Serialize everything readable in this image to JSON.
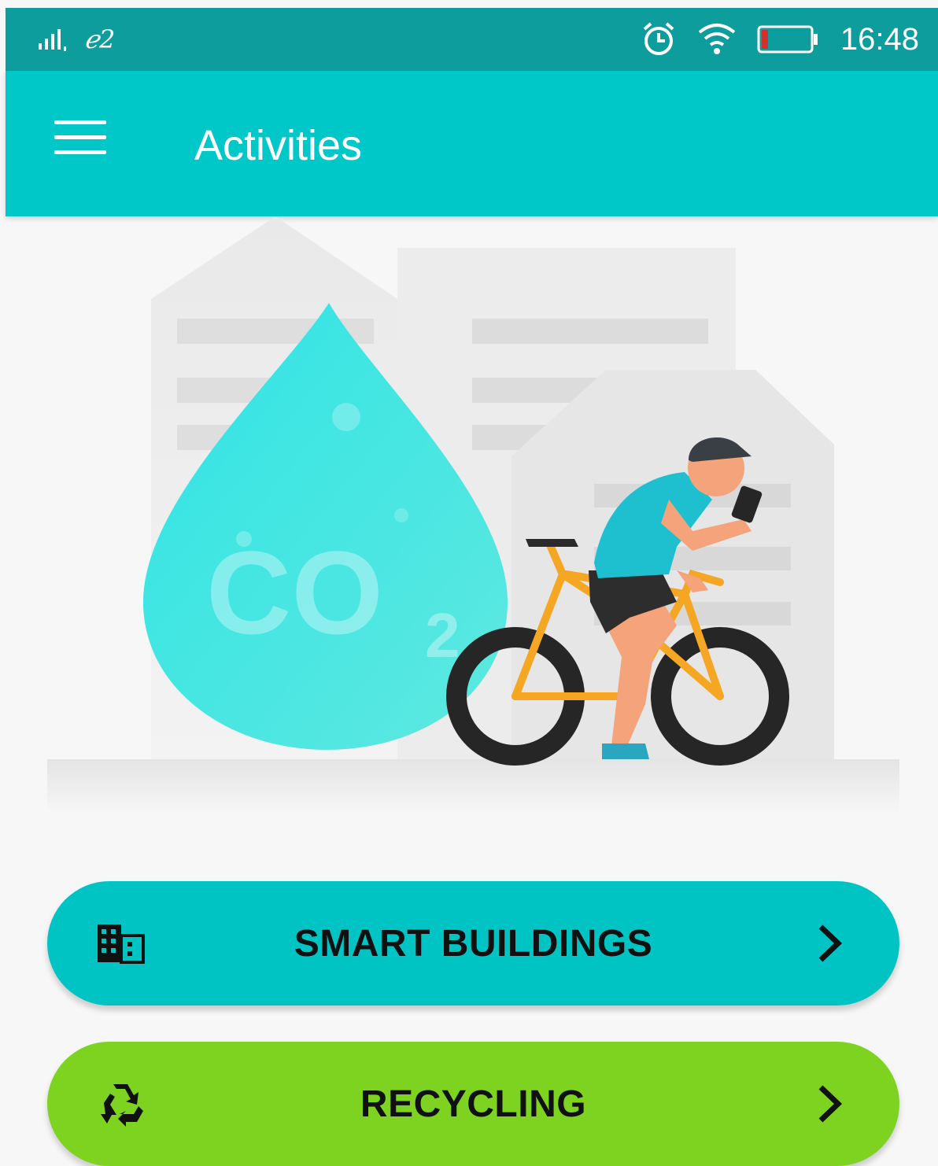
{
  "status_bar": {
    "carrier": "ℯ2",
    "time": "16:48",
    "icons": [
      "signal-icon",
      "alarm-icon",
      "wifi-icon",
      "battery-low-icon"
    ]
  },
  "app_bar": {
    "title": "Activities",
    "menu_icon": "hamburger-menu-icon"
  },
  "hero": {
    "co2_text": "CO",
    "co2_subscript": "2"
  },
  "buttons": [
    {
      "label": "SMART BUILDINGS",
      "icon": "building-icon",
      "trailing_icon": "chevron-right-icon",
      "color": "#00c4c4"
    },
    {
      "label": "RECYCLING",
      "icon": "recycle-icon",
      "trailing_icon": "chevron-right-icon",
      "color": "#7ed321"
    }
  ],
  "colors": {
    "status_bar": "#0e9d9d",
    "app_bar": "#00c8c8",
    "background": "#f7f7f7",
    "battery_low": "#d32f2f"
  }
}
